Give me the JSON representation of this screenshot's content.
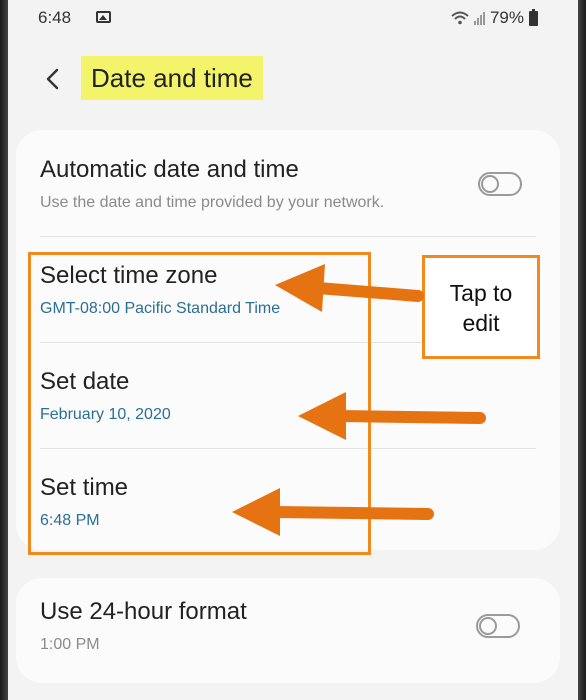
{
  "statusbar": {
    "time": "6:48",
    "battery": "79%"
  },
  "header": {
    "title": "Date and time"
  },
  "settings": {
    "automatic": {
      "label": "Automatic date and time",
      "sub": "Use the date and time provided by your network.",
      "toggle_on": false
    },
    "timezone": {
      "label": "Select time zone",
      "value": "GMT-08:00 Pacific Standard Time"
    },
    "date": {
      "label": "Set date",
      "value": "February 10, 2020"
    },
    "time": {
      "label": "Set time",
      "value": "6:48 PM"
    },
    "format24": {
      "label": "Use 24-hour format",
      "sub": "1:00 PM",
      "toggle_on": false
    }
  },
  "annotation": {
    "callout_line1": "Tap to",
    "callout_line2": "edit",
    "highlight_color": "#f4f46a",
    "accent_color": "#f08a1c",
    "value_color": "#2b6f93"
  },
  "icons": {
    "back": "chevron-left-icon",
    "gallery": "image-icon",
    "wifi": "wifi-icon",
    "signal": "signal-icon",
    "battery": "battery-icon"
  }
}
